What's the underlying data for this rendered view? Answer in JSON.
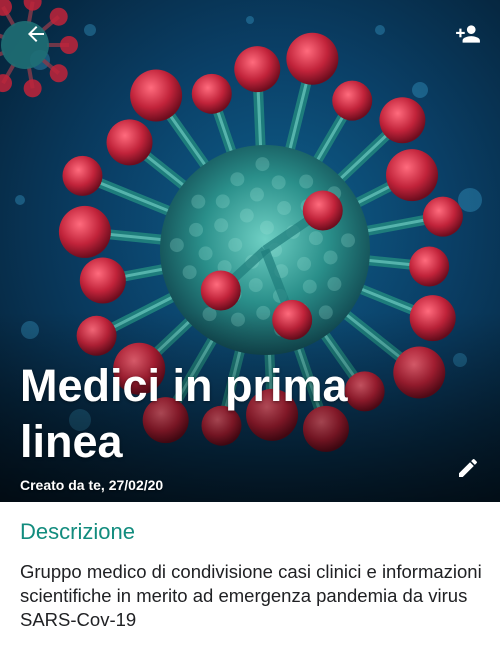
{
  "header": {
    "back_icon": "arrow-left-icon",
    "add_member_icon": "person-add-icon",
    "edit_icon": "pencil-icon"
  },
  "group": {
    "title": "Medici in prima linea",
    "created": "Creato da te, 27/02/20",
    "photo": "coronavirus-illustration"
  },
  "description": {
    "heading": "Descrizione",
    "text": "Gruppo medico di condivisione casi clinici e informazioni scientifiche in merito ad emergenza pandemia da virus SARS-Cov-19"
  },
  "colors": {
    "accent": "#128c7e",
    "virus_spikes": "#c1233a",
    "virus_core": "#2a8f8a"
  }
}
